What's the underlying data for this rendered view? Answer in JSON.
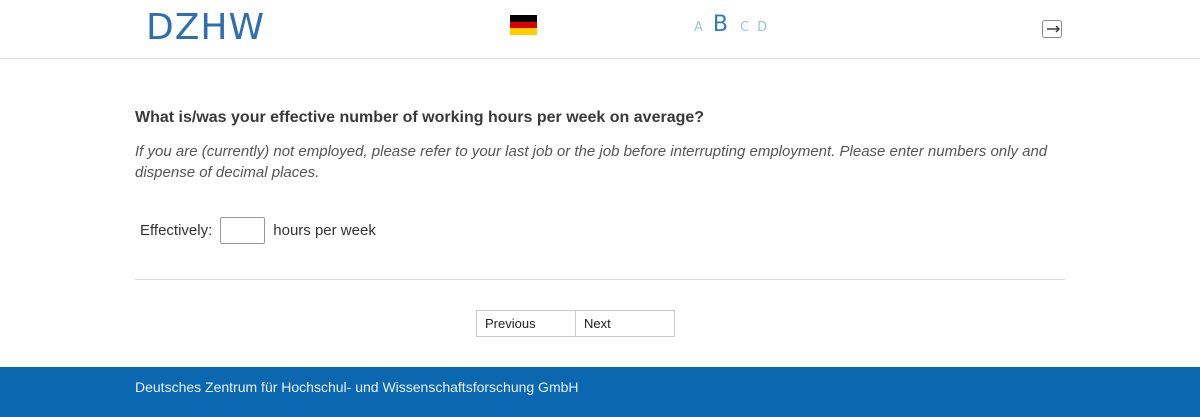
{
  "header": {
    "logo_text": "DZHW",
    "language_flag": "german-flag-icon",
    "flag_colors": [
      "#000000",
      "#dd0000",
      "#ffce00"
    ],
    "font_size_options": [
      "A",
      "B",
      "C",
      "D"
    ],
    "selected_font_size": "B",
    "logout_icon": "logout-icon"
  },
  "question": {
    "title": "What is/was your effective number of working hours per week on average?",
    "instruction": "If you are (currently) not employed, please refer to your last job or the job before interrupting employment. Please enter numbers only and dispense of decimal places.",
    "field_label": "Effectively:",
    "field_value": "",
    "field_suffix": "hours per week"
  },
  "navigation": {
    "previous_label": "Previous",
    "next_label": "Next"
  },
  "footer": {
    "text": "Deutsches Zentrum für Hochschul- und Wissenschaftsforschung GmbH",
    "background": "#0a67b0"
  }
}
